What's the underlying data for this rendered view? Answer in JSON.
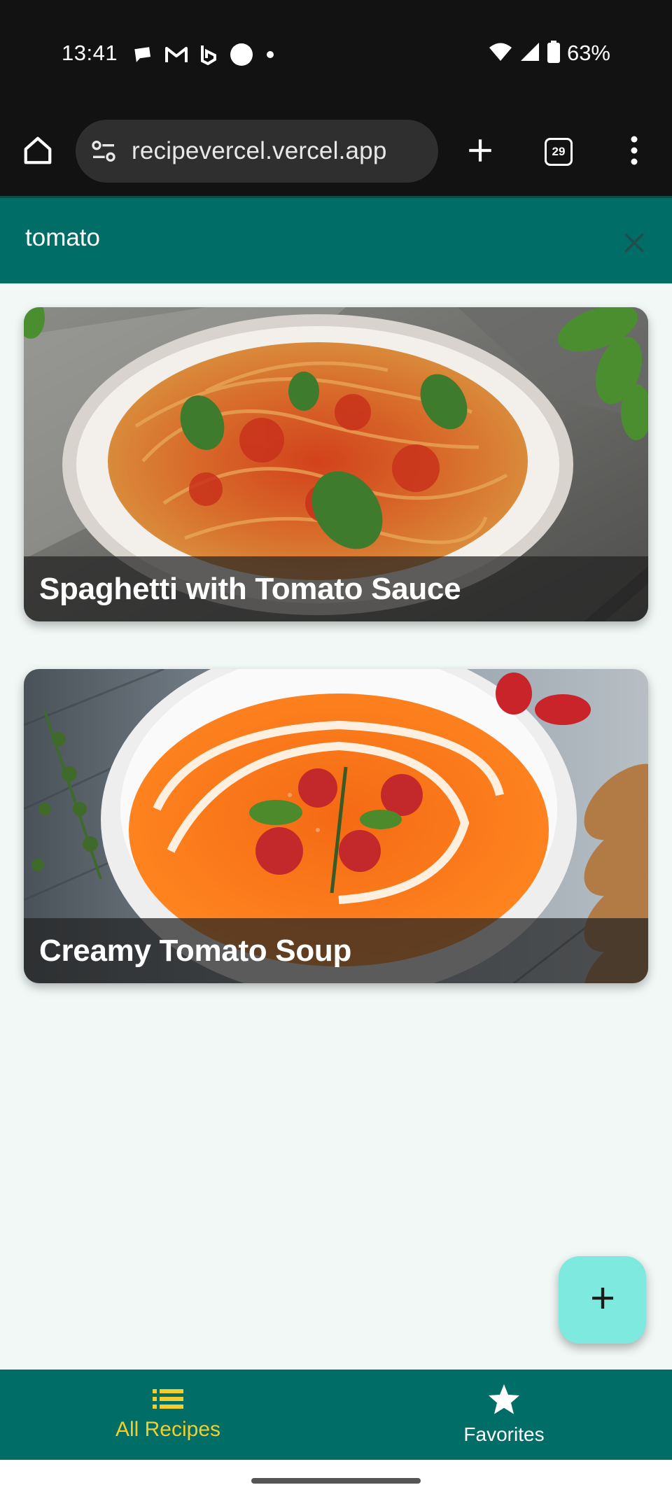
{
  "status_bar": {
    "time": "13:41",
    "battery": "63%",
    "icons": [
      "chat-bubble-icon",
      "gmail-icon",
      "bing-icon",
      "circle-icon",
      "dot-icon",
      "wifi-icon",
      "signal-icon",
      "battery-icon"
    ]
  },
  "browser": {
    "url": "recipevercel.vercel.app",
    "tab_count": "29"
  },
  "search": {
    "query": "tomato"
  },
  "recipes": [
    {
      "title": "Spaghetti with Tomato Sauce"
    },
    {
      "title": "Creamy Tomato Soup"
    }
  ],
  "nav": {
    "all_recipes": "All Recipes",
    "favorites": "Favorites",
    "active": "all_recipes"
  },
  "colors": {
    "primary": "#006d66",
    "accent": "#f3cd2b",
    "fab": "#7ee9df",
    "background": "#f1f8f6"
  }
}
